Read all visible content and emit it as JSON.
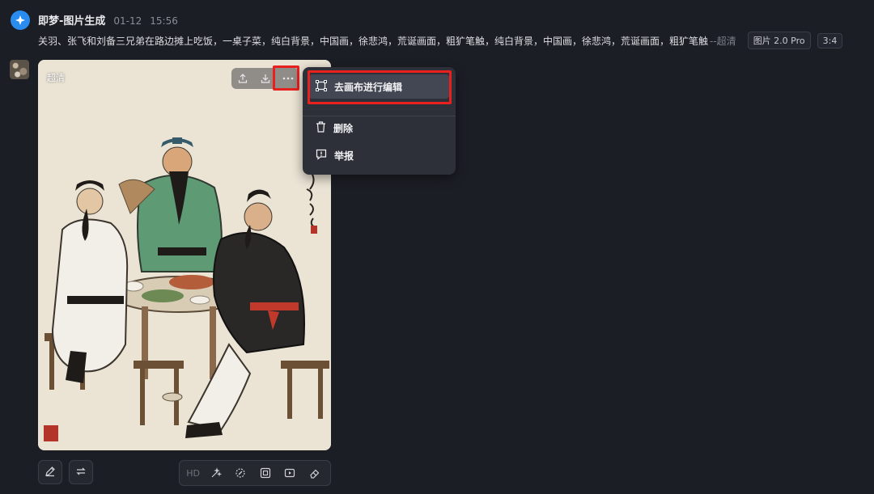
{
  "header": {
    "app_name": "即梦-图片生成",
    "date": "01-12",
    "time": "15:56"
  },
  "prompt": {
    "text": "关羽、张飞和刘备三兄弟在路边摊上吃饭，一桌子菜，纯白背景，中国画，徐悲鸿，荒诞画面，粗犷笔触，纯白背景，中国画，徐悲鸿，荒诞画面，粗犷笔触",
    "suffix": "--超清"
  },
  "tags": {
    "model": "图片 2.0 Pro",
    "ratio": "3:4"
  },
  "image": {
    "quality_label": "超清",
    "toolbar": [
      "share-icon",
      "download-icon",
      "more-icon"
    ]
  },
  "context_menu": {
    "items": [
      {
        "label": "去画布进行编辑",
        "icon": "canvas-edit-icon"
      },
      {
        "label": "删除",
        "icon": "trash-icon"
      },
      {
        "label": "举报",
        "icon": "report-icon"
      }
    ]
  },
  "bottom_bar": {
    "left_buttons": [
      "pen-edit-icon",
      "regenerate-icon"
    ],
    "hd_label": "HD",
    "tools": [
      "magic-wand-icon",
      "inpaint-icon",
      "expand-frame-icon",
      "to-video-icon",
      "eraser-icon"
    ]
  },
  "colors": {
    "background": "#1c1e26",
    "highlight": "#e8211f",
    "menu_bg": "#2e3039",
    "logo_blue": "#2b8cf0"
  }
}
